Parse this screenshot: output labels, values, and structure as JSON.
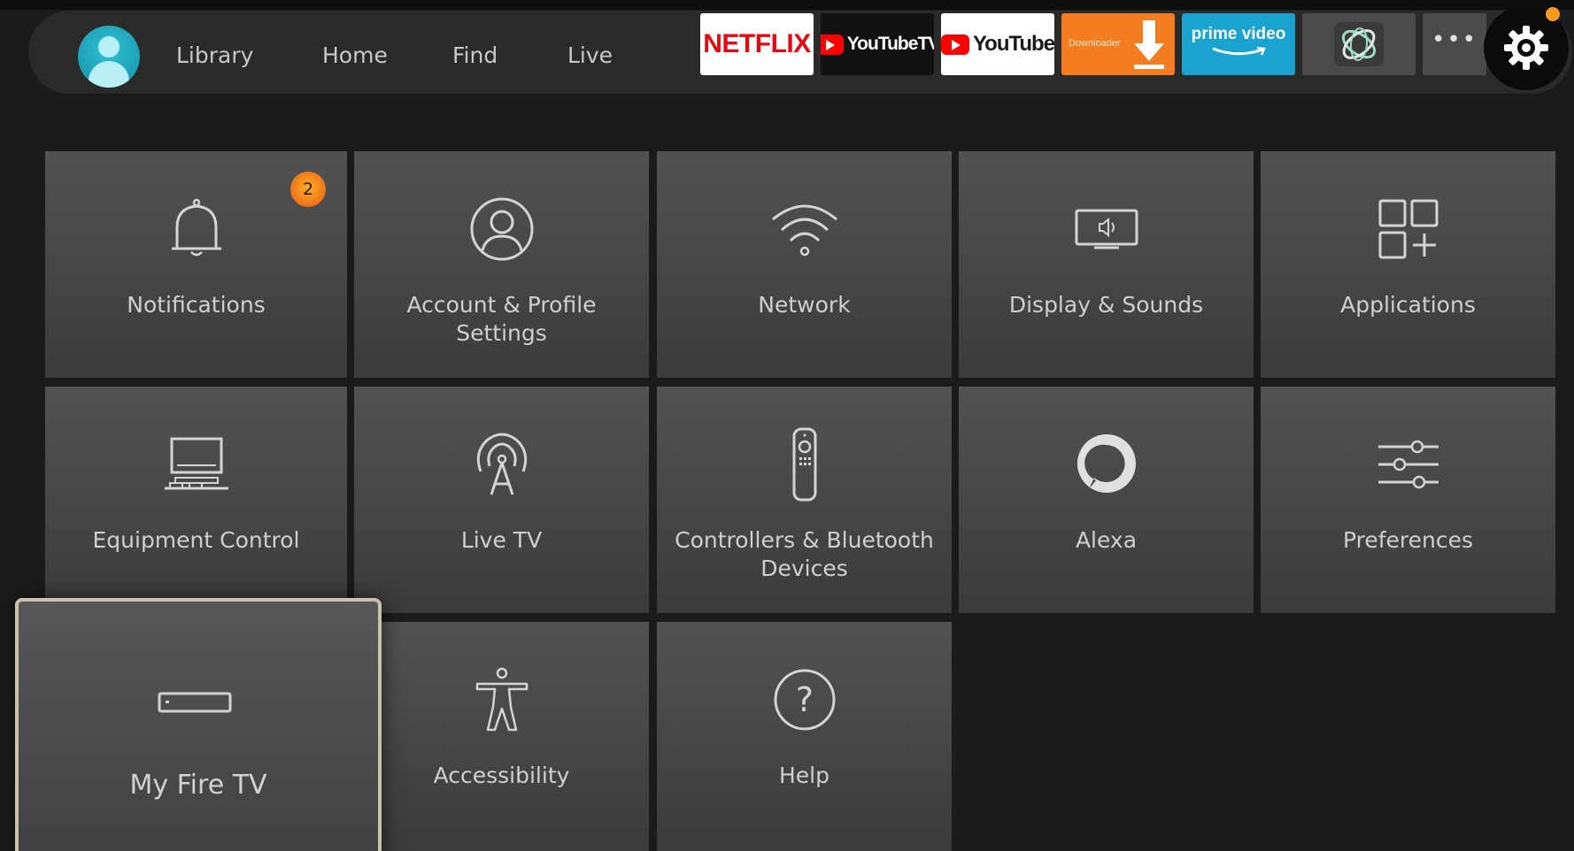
{
  "nav": {
    "items": [
      {
        "label": "Library"
      },
      {
        "label": "Home"
      },
      {
        "label": "Find"
      },
      {
        "label": "Live"
      }
    ],
    "apps": {
      "netflix": "NETFLIX",
      "youtube_tv": "YouTubeTV",
      "youtube": "YouTube",
      "downloader": "Downloader",
      "prime_video": "prime video",
      "more": "•••"
    }
  },
  "settings": {
    "tiles": [
      {
        "label": "Notifications",
        "badge": "2"
      },
      {
        "label": "Account & Profile Settings"
      },
      {
        "label": "Network"
      },
      {
        "label": "Display & Sounds"
      },
      {
        "label": "Applications"
      },
      {
        "label": "Equipment Control"
      },
      {
        "label": "Live TV"
      },
      {
        "label": "Controllers & Bluetooth Devices"
      },
      {
        "label": "Alexa"
      },
      {
        "label": "Preferences"
      },
      {
        "label": "My Fire TV"
      },
      {
        "label": "Accessibility"
      },
      {
        "label": "Help"
      }
    ],
    "focused_tile": "My Fire TV"
  },
  "colors": {
    "background": "#1b1b1b",
    "nav_bar": "#2a2a2a",
    "tile": "#4a4a4a",
    "focus_border": "#c9c2ac",
    "badge": "#f0801c",
    "text": "#cfcfcf"
  }
}
